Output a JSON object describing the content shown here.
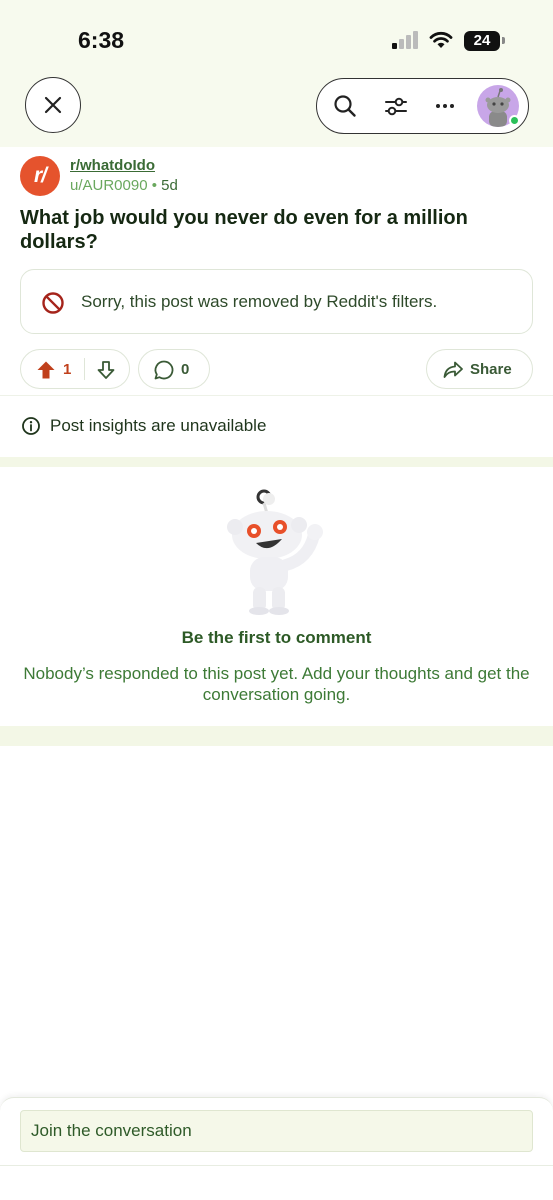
{
  "status_bar": {
    "time": "6:38",
    "battery": "24"
  },
  "nav": {
    "close_icon": "close-icon",
    "search_icon": "search-icon",
    "filter_icon": "sliders-icon",
    "more_icon": "more-horizontal-icon",
    "avatar": "snoo-avatar"
  },
  "post": {
    "subreddit": "r/whatdoIdo",
    "subreddit_icon_text": "r/",
    "author": "u/AUR0090",
    "separator": "•",
    "age": "5d",
    "title": "What job would you never do even for a million dollars?",
    "removed_notice": "Sorry, this post was removed by Reddit's filters.",
    "upvotes": "1",
    "comments": "0",
    "share_label": "Share",
    "insights": "Post insights are unavailable"
  },
  "empty_state": {
    "title": "Be the first to comment",
    "text": "Nobody’s responded to this post yet. Add your thoughts and get the conversation going."
  },
  "composer": {
    "placeholder": "Join the conversation"
  },
  "colors": {
    "accent_green": "#3a6b35",
    "upvote_orange": "#c0401c",
    "subreddit_orange": "#e5532d",
    "tint_background": "#f7faee"
  }
}
